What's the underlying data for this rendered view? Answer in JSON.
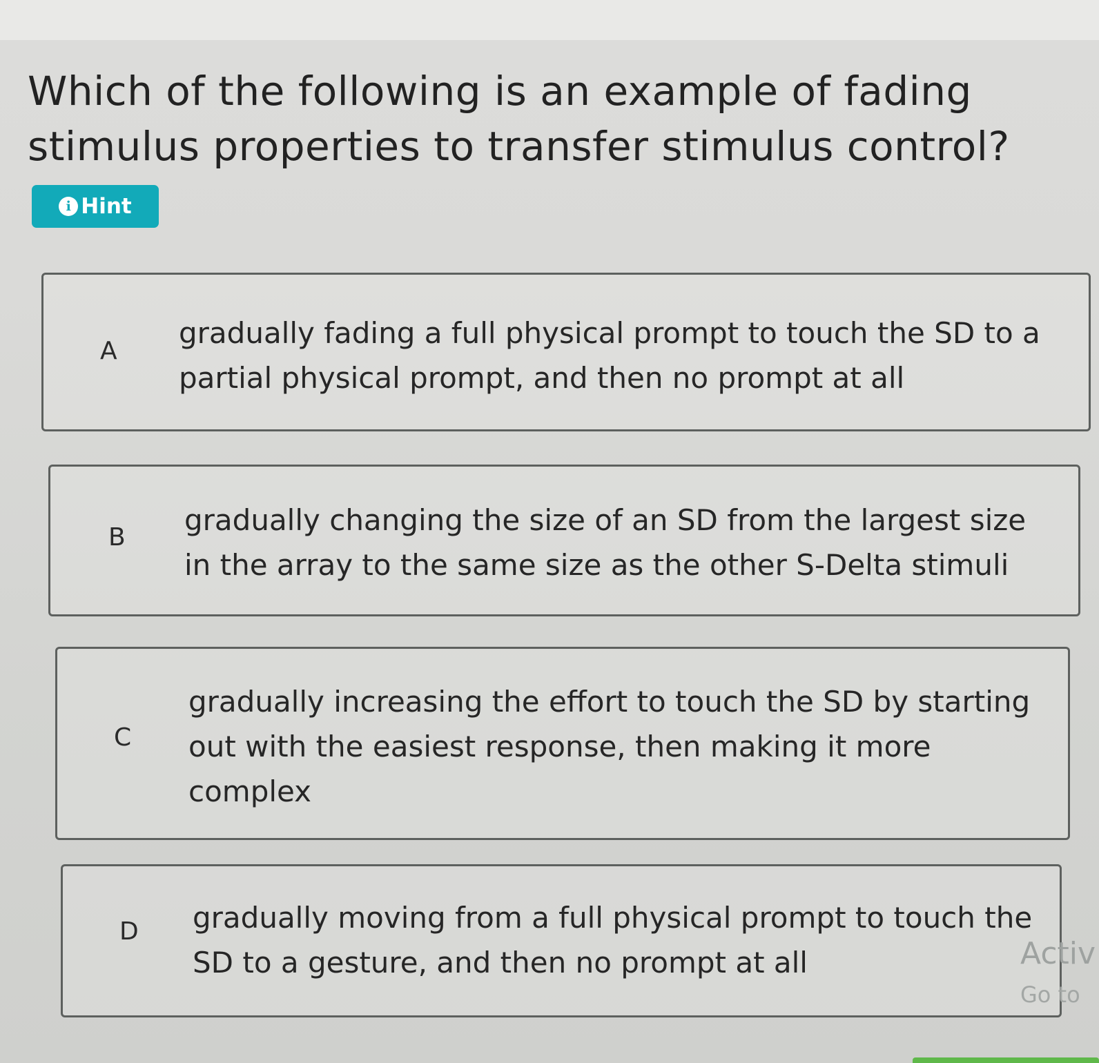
{
  "question": {
    "line1": "Which of the following is an example of fading",
    "line2": "stimulus properties to transfer stimulus control?"
  },
  "hint": {
    "icon_glyph": "i",
    "label": "Hint",
    "color": "#12aab9"
  },
  "options": [
    {
      "letter": "A",
      "text": "gradually fading a full physical prompt to touch the SD to a partial physical prompt, and then no prompt at all"
    },
    {
      "letter": "B",
      "text": "gradually changing the size of an SD from the largest size in the array to the same size as the other S-Delta stimuli"
    },
    {
      "letter": "C",
      "text": "gradually increasing the effort to touch the SD by starting out with the easiest response, then making it more complex"
    },
    {
      "letter": "D",
      "text": "gradually moving from a full physical prompt to touch the SD to a gesture, and then no prompt at all"
    }
  ],
  "watermark": {
    "line1": "Activ",
    "line2": "Go to"
  }
}
